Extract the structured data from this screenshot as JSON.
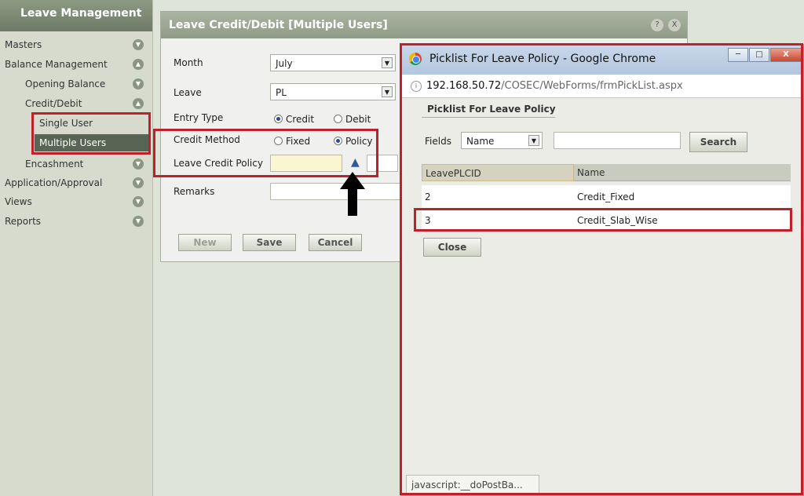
{
  "sidebar": {
    "title": "Leave Management",
    "items": [
      {
        "label": "Masters",
        "icon": "expand-icon"
      },
      {
        "label": "Balance Management",
        "icon": "collapse-icon"
      },
      {
        "label": "Opening Balance",
        "icon": "expand-icon"
      },
      {
        "label": "Credit/Debit",
        "icon": "collapse-icon"
      },
      {
        "label": "Single User"
      },
      {
        "label": "Multiple Users"
      },
      {
        "label": "Encashment",
        "icon": "expand-icon"
      },
      {
        "label": "Application/Approval",
        "icon": "expand-icon"
      },
      {
        "label": "Views",
        "icon": "expand-icon"
      },
      {
        "label": "Reports",
        "icon": "expand-icon"
      }
    ]
  },
  "dialog": {
    "title": "Leave Credit/Debit [Multiple Users]",
    "help": "?",
    "close": "X",
    "fields": {
      "month_label": "Month",
      "month_value": "July",
      "leave_label": "Leave",
      "leave_value": "PL",
      "entry_type_label": "Entry Type",
      "credit_label": "Credit",
      "debit_label": "Debit",
      "credit_method_label": "Credit Method",
      "fixed_label": "Fixed",
      "policy_label": "Policy",
      "leave_credit_policy_label": "Leave Credit Policy",
      "remarks_label": "Remarks"
    },
    "buttons": {
      "new": "New",
      "save": "Save",
      "cancel": "Cancel"
    }
  },
  "popup": {
    "title": "Picklist For Leave Policy - Google Chrome",
    "url_host": "192.168.50.72",
    "url_rest": "/COSEC/WebForms/frmPickList.aspx",
    "section_title": "Picklist For Leave Policy",
    "fields_label": "Fields",
    "fields_value": "Name",
    "search_button": "Search",
    "columns": [
      "LeavePLCID",
      "Name"
    ],
    "rows": [
      {
        "id": "2",
        "name": "Credit_Fixed"
      },
      {
        "id": "3",
        "name": "Credit_Slab_Wise"
      }
    ],
    "close_button": "Close",
    "status_text": "javascript:__doPostBa..."
  },
  "colors": {
    "highlight": "#c0202a",
    "active_row": "#586454"
  }
}
